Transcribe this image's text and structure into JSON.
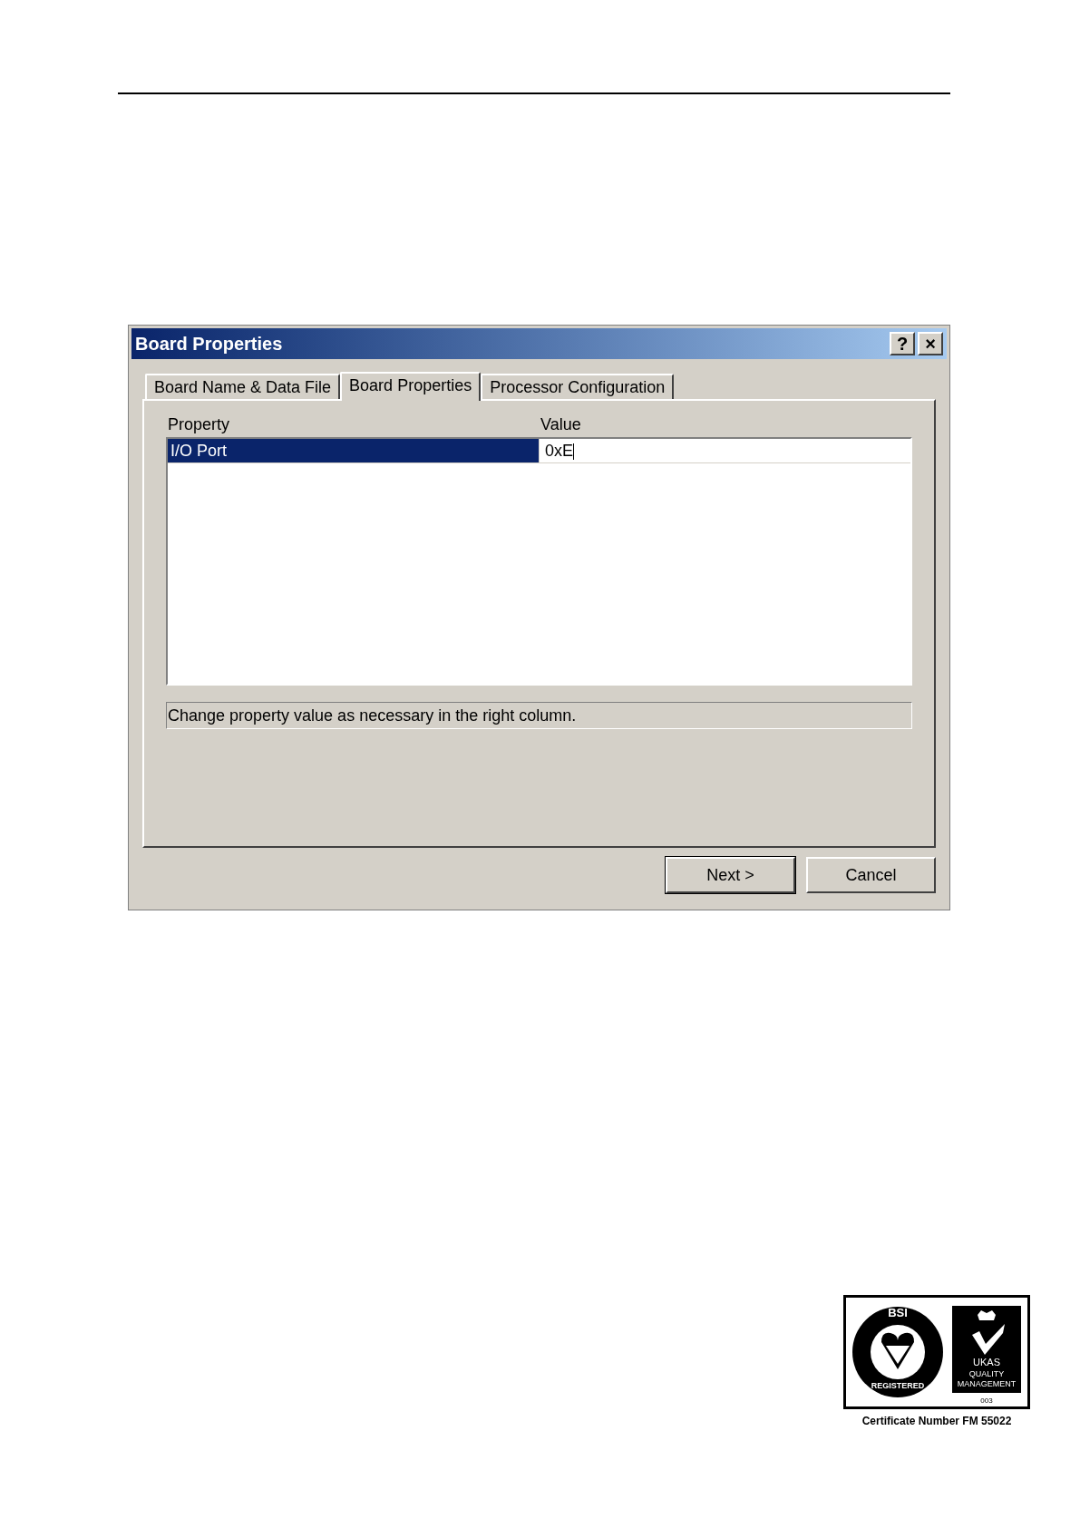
{
  "window": {
    "title": "Board Properties",
    "title_buttons": [
      "?",
      "×"
    ]
  },
  "tabs": [
    {
      "label": "Board Name & Data File",
      "selected": false
    },
    {
      "label": "Board Properties",
      "selected": true
    },
    {
      "label": "Processor Configuration",
      "selected": false
    }
  ],
  "table": {
    "columns": [
      "Property",
      "Value"
    ],
    "rows": [
      {
        "property": "I/O Port",
        "value": "0xE",
        "selected": true
      }
    ]
  },
  "status_text": "Change property value as necessary in the right column.",
  "buttons": [
    {
      "label": "Next >",
      "default": true
    },
    {
      "label": "Cancel",
      "default": false
    }
  ],
  "certification": {
    "seal_top": "BSI",
    "seal_ring": "REGISTERED",
    "mark_name": "UKAS",
    "mark_line_1": "QUALITY",
    "mark_line_2": "MANAGEMENT",
    "mark_number": "003",
    "caption": "Certificate Number FM 55022"
  }
}
